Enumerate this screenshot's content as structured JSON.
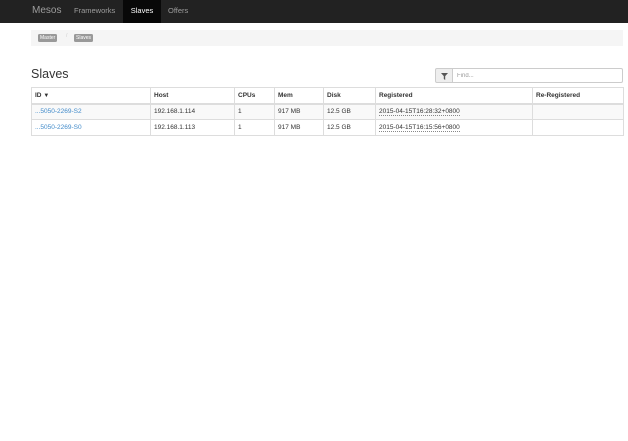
{
  "navbar": {
    "brand": "Mesos",
    "items": [
      {
        "label": "Frameworks",
        "active": false
      },
      {
        "label": "Slaves",
        "active": true
      },
      {
        "label": "Offers",
        "active": false
      }
    ]
  },
  "breadcrumb": {
    "items": [
      "Master",
      "Slaves"
    ],
    "separator": "/"
  },
  "page": {
    "title": "Slaves"
  },
  "filter": {
    "placeholder": "Find...",
    "value": "",
    "icon": "filter-icon"
  },
  "table": {
    "columns": [
      "ID",
      "Host",
      "CPUs",
      "Mem",
      "Disk",
      "Registered",
      "Re-Registered"
    ],
    "sort_indicator": "▼",
    "rows": [
      {
        "id": "...5050-2269-S2",
        "host": "192.168.1.114",
        "cpus": "1",
        "mem": "917 MB",
        "disk": "12.5 GB",
        "registered": "2015-04-15T16:28:32+0800",
        "reregistered": ""
      },
      {
        "id": "...5050-2269-S0",
        "host": "192.168.1.113",
        "cpus": "1",
        "mem": "917 MB",
        "disk": "12.5 GB",
        "registered": "2015-04-15T16:15:56+0800",
        "reregistered": ""
      }
    ]
  },
  "colors": {
    "navbar_bg": "#222222",
    "nav_active_bg": "#080808",
    "link": "#428bca",
    "breadcrumb_label": "#999999"
  }
}
